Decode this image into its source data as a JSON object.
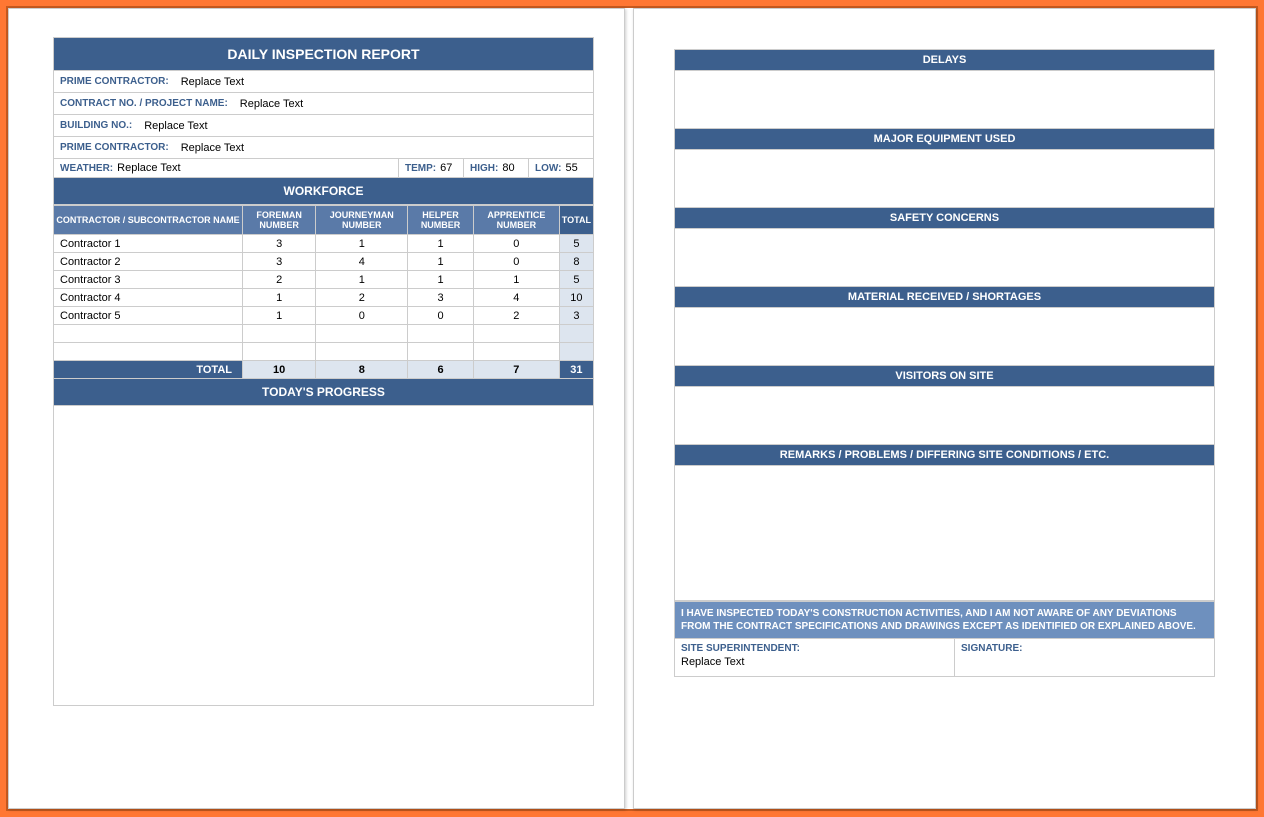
{
  "title": "DAILY INSPECTION REPORT",
  "fields": {
    "prime_contractor_label": "PRIME CONTRACTOR:",
    "prime_contractor_value": "Replace Text",
    "contract_no_label": "CONTRACT NO. / PROJECT NAME:",
    "contract_no_value": "Replace Text",
    "building_no_label": "BUILDING NO.:",
    "building_no_value": "Replace Text",
    "prime_contractor2_label": "PRIME CONTRACTOR:",
    "prime_contractor2_value": "Replace Text",
    "weather_label": "WEATHER:",
    "weather_value": "Replace Text",
    "temp_label": "TEMP:",
    "temp_value": "67",
    "high_label": "HIGH:",
    "high_value": "80",
    "low_label": "LOW:",
    "low_value": "55"
  },
  "workforce_header": "WORKFORCE",
  "workforce_columns": [
    "CONTRACTOR / SUBCONTRACTOR NAME",
    "FOREMAN NUMBER",
    "JOURNEYMAN NUMBER",
    "HELPER NUMBER",
    "APPRENTICE NUMBER",
    "TOTAL"
  ],
  "workforce_rows": [
    {
      "name": "Contractor 1",
      "foreman": "3",
      "journeyman": "1",
      "helper": "1",
      "apprentice": "0",
      "total": "5"
    },
    {
      "name": "Contractor 2",
      "foreman": "3",
      "journeyman": "4",
      "helper": "1",
      "apprentice": "0",
      "total": "8"
    },
    {
      "name": "Contractor 3",
      "foreman": "2",
      "journeyman": "1",
      "helper": "1",
      "apprentice": "1",
      "total": "5"
    },
    {
      "name": "Contractor 4",
      "foreman": "1",
      "journeyman": "2",
      "helper": "3",
      "apprentice": "4",
      "total": "10"
    },
    {
      "name": "Contractor 5",
      "foreman": "1",
      "journeyman": "0",
      "helper": "0",
      "apprentice": "2",
      "total": "3"
    }
  ],
  "workforce_total_label": "TOTAL",
  "workforce_totals": {
    "foreman": "10",
    "journeyman": "8",
    "helper": "6",
    "apprentice": "7",
    "total": "31"
  },
  "todays_progress": "TODAY'S PROGRESS",
  "right": {
    "delays": "DELAYS",
    "major_equipment": "MAJOR EQUIPMENT USED",
    "safety": "SAFETY CONCERNS",
    "material": "MATERIAL RECEIVED / SHORTAGES",
    "visitors": "VISITORS ON SITE",
    "remarks": "REMARKS / PROBLEMS / DIFFERING SITE CONDITIONS / ETC.",
    "statement": "I HAVE INSPECTED TODAY'S CONSTRUCTION ACTIVITIES, AND I AM NOT AWARE OF ANY DEVIATIONS FROM THE CONTRACT SPECIFICATIONS AND DRAWINGS EXCEPT AS IDENTIFIED OR EXPLAINED ABOVE.",
    "sig_label": "SITE SUPERINTENDENT:",
    "sig_value": "Replace Text",
    "signature_label": "SIGNATURE:"
  }
}
